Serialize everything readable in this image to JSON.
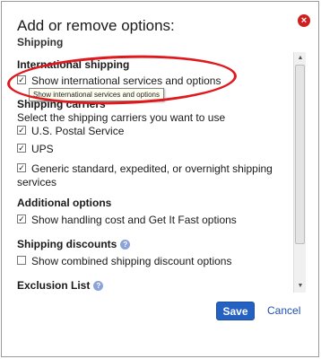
{
  "dialog": {
    "title": "Add or remove options:",
    "subtitle": "Shipping",
    "close_icon": "close-icon"
  },
  "sections": {
    "international": {
      "heading": "International shipping",
      "option": {
        "label": "Show international services and options",
        "checked": true
      },
      "tooltip": "Show international services and options"
    },
    "carriers": {
      "heading": "Shipping carriers",
      "instruction": "Select the shipping carriers you want to use",
      "options": [
        {
          "label": "U.S. Postal Service",
          "checked": true
        },
        {
          "label": "UPS",
          "checked": true
        },
        {
          "label": "Generic standard, expedited, or overnight shipping",
          "label2": "services",
          "checked": true
        }
      ]
    },
    "additional": {
      "heading": "Additional options",
      "option": {
        "label": "Show handling cost and Get It Fast options",
        "checked": true
      }
    },
    "discounts": {
      "heading": "Shipping discounts",
      "option": {
        "label": "Show combined shipping discount options",
        "checked": false
      }
    },
    "exclusion": {
      "heading": "Exclusion List"
    }
  },
  "buttons": {
    "save": "Save",
    "cancel": "Cancel"
  },
  "help_icon": "?",
  "check_mark": "✓",
  "colors": {
    "save_bg": "#2561c3",
    "close_bg": "#d01f1f",
    "annotation": "#e0191f",
    "link": "#1f4fb0"
  }
}
